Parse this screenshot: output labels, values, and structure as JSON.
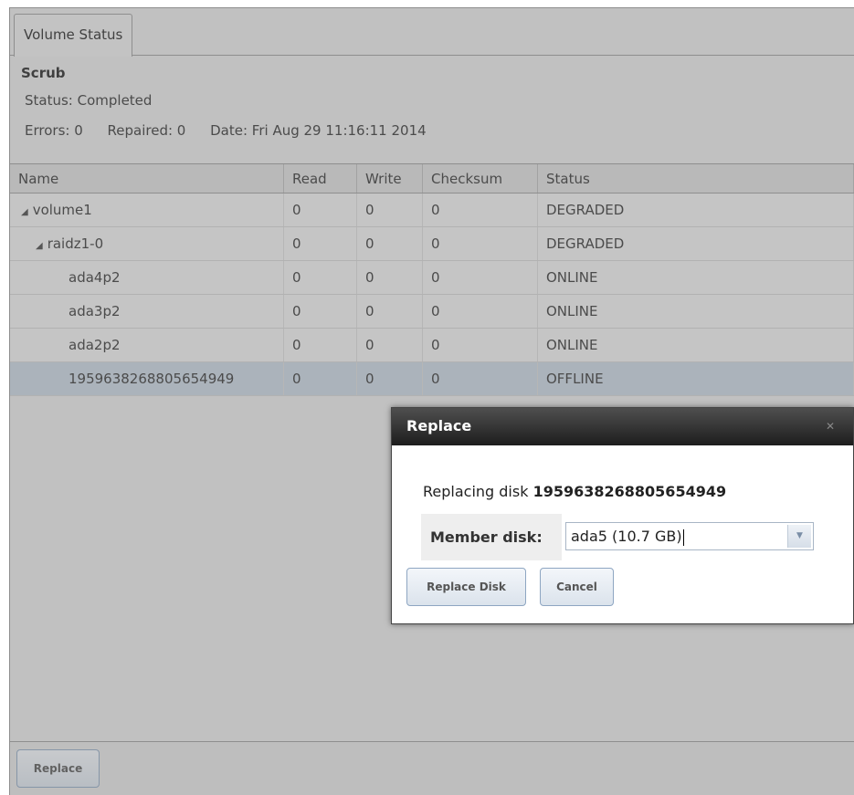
{
  "tab": {
    "label": "Volume Status"
  },
  "scrub": {
    "title": "Scrub",
    "status": "Status: Completed",
    "errors": "Errors: 0",
    "repaired": "Repaired: 0",
    "date": "Date: Fri Aug 29 11:16:11 2014"
  },
  "table": {
    "headers": [
      "Name",
      "Read",
      "Write",
      "Checksum",
      "Status"
    ],
    "rows": [
      {
        "name": "volume1",
        "expander": "◢",
        "read": "0",
        "write": "0",
        "checksum": "0",
        "status": "DEGRADED"
      },
      {
        "name": "raidz1-0",
        "expander": "◢",
        "read": "0",
        "write": "0",
        "checksum": "0",
        "status": "DEGRADED"
      },
      {
        "name": "ada4p2",
        "read": "0",
        "write": "0",
        "checksum": "0",
        "status": "ONLINE"
      },
      {
        "name": "ada3p2",
        "read": "0",
        "write": "0",
        "checksum": "0",
        "status": "ONLINE"
      },
      {
        "name": "ada2p2",
        "read": "0",
        "write": "0",
        "checksum": "0",
        "status": "ONLINE"
      },
      {
        "name": "1959638268805654949",
        "read": "0",
        "write": "0",
        "checksum": "0",
        "status": "OFFLINE"
      }
    ]
  },
  "bottom": {
    "replace_label": "Replace"
  },
  "dialog": {
    "title": "Replace",
    "replacing_prefix": "Replacing disk",
    "replacing_disk": "1959638268805654949",
    "member_label": "Member disk:",
    "member_value": "ada5 (10.7 GB)",
    "replace_disk_label": "Replace Disk",
    "cancel_label": "Cancel"
  }
}
